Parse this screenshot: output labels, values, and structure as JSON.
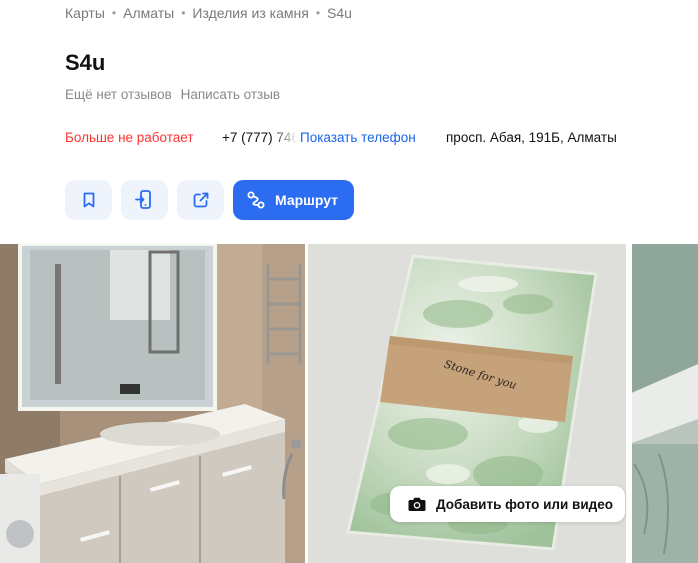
{
  "breadcrumb": {
    "items": [
      "Карты",
      "Алматы",
      "Изделия из камня",
      "S4u"
    ]
  },
  "org": {
    "name": "S4u",
    "no_reviews": "Ещё нет отзывов",
    "write_review": "Написать отзыв",
    "status": "Больше не работает",
    "phone_partial": "+7 (777) 746",
    "show_phone": "Показать телефон",
    "address": "просп. Абая, 191Б, Алматы"
  },
  "actions": {
    "bookmark_icon": "bookmark-icon",
    "send_to_phone_icon": "phone-send-icon",
    "share_icon": "share-icon",
    "route_label": "Маршрут"
  },
  "gallery": {
    "photo_caption": "Stone for you",
    "add_photo_label": "Добавить фото или видео"
  },
  "colors": {
    "accent": "#2b6cf0",
    "link": "#1a64e8",
    "closed": "#ff3333",
    "button_bg": "#eef3fc"
  }
}
